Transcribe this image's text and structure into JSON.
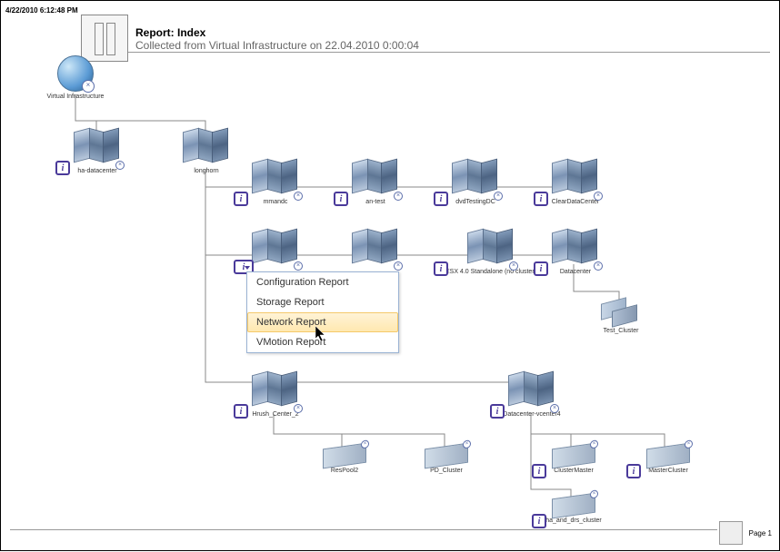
{
  "meta": {
    "timestamp": "4/22/2010 6:12:48 PM",
    "title": "Report: Index",
    "subtitle": "Collected from Virtual Infrastructure on 22.04.2010 0:00:04",
    "footer": "Page 1"
  },
  "nodes": {
    "root": "Virtual Infrastructure",
    "ha_dc": "ha-datacenter",
    "longhorn": "longhorn",
    "mmandc": "mmandc",
    "an_test": "an-test",
    "dvd_testing": "dvdTestingDC",
    "clear_dc": "ClearDataCenter",
    "esx40": "ESX 4.0 Standalone (no cluster)",
    "datacenter": "Datacenter",
    "test_cluster": "Test_Cluster",
    "hrush": "Hrush_Center_2",
    "dc_vcenter4": "Datacenter-vcenter4",
    "respool2": "ResPool2",
    "pd_cluster": "PD_Cluster",
    "cluster_master": "ClusterMaster",
    "master_cluster": "MasterCluster",
    "ha_drs": "ha_and_drs_cluster"
  },
  "menu": {
    "items": [
      "Configuration Report",
      "Storage Report",
      "Network Report",
      "VMotion Report"
    ],
    "hover_index": 2
  }
}
